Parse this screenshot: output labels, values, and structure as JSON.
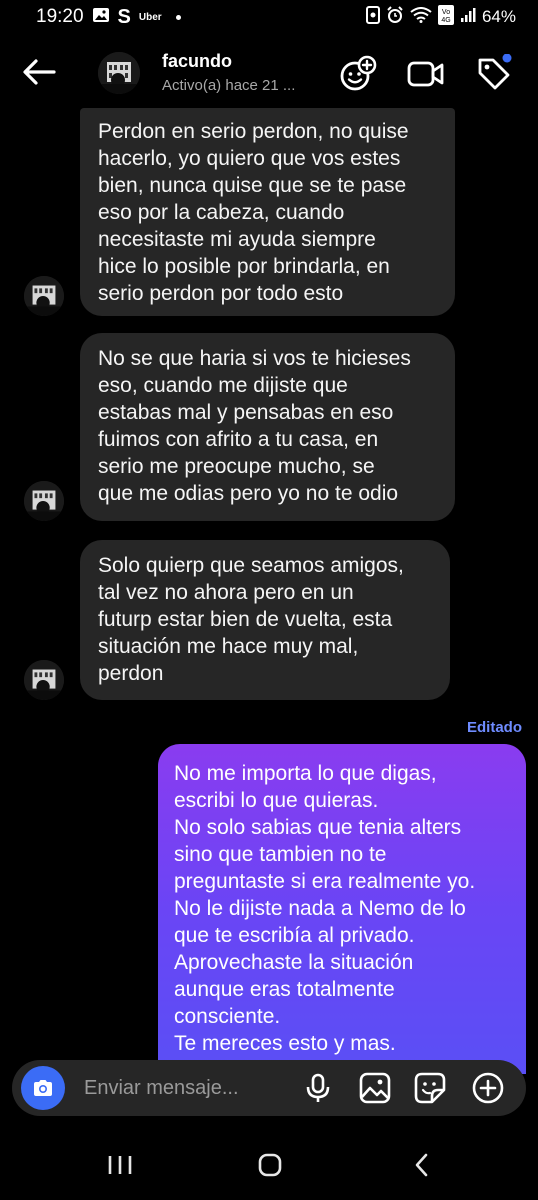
{
  "status_bar": {
    "time": "19:20",
    "app_label": "Uber",
    "battery": "64%"
  },
  "header": {
    "name": "facundo",
    "status": "Activo(a) hace 21 ..."
  },
  "messages": [
    {
      "direction": "in",
      "lines": [
        "Perdon en serio perdon, no quise",
        "hacerlo, yo quiero que vos estes",
        "bien, nunca quise que se te pase",
        "eso por la cabeza, cuando",
        "necesitaste mi ayuda siempre",
        "hice lo posible por brindarla, en",
        "serio perdon por todo esto"
      ]
    },
    {
      "direction": "in",
      "lines": [
        "No se que haria si vos te hicieses",
        "eso, cuando me dijiste que",
        "estabas mal y pensabas en eso",
        "fuimos con afrito a tu casa, en",
        "serio me preocupe mucho, se",
        "que me odias pero yo no te odio"
      ]
    },
    {
      "direction": "in",
      "lines": [
        "Solo quierp que seamos amigos,",
        "tal vez no ahora pero en un",
        "futurp estar bien de vuelta, esta",
        "situación me hace muy mal,",
        "perdon"
      ]
    },
    {
      "direction": "out",
      "edited_label": "Editado",
      "lines": [
        "No me importa lo que digas,",
        "escribi lo que quieras.",
        "No solo sabias que tenia alters",
        "sino que tambien no te",
        "preguntaste si era realmente yo.",
        "No le dijiste nada a Nemo de lo",
        "que te escribía al privado.",
        "Aprovechaste la situación",
        "aunque eras totalmente",
        "consciente.",
        "Te mereces esto y mas."
      ]
    }
  ],
  "composer": {
    "placeholder": "Enviar mensaje..."
  },
  "colors": {
    "accent": "#3b6cf6",
    "edited": "#6f8cff",
    "bubble_in": "#262626",
    "bubble_out_top": "#8a3cf0",
    "bubble_out_bottom": "#5a4ff5"
  },
  "icons": [
    "back-arrow-icon",
    "sticker-add-icon",
    "video-call-icon",
    "tag-icon",
    "camera-icon",
    "microphone-icon",
    "gallery-icon",
    "sticker-icon",
    "plus-icon"
  ]
}
